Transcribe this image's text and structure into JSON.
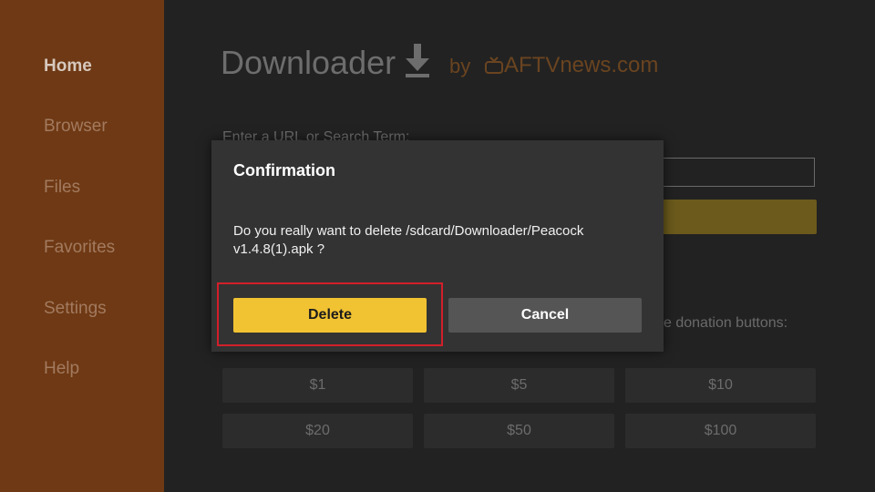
{
  "sidebar": {
    "items": [
      {
        "label": "Home",
        "active": true
      },
      {
        "label": "Browser"
      },
      {
        "label": "Files"
      },
      {
        "label": "Favorites"
      },
      {
        "label": "Settings"
      },
      {
        "label": "Help"
      }
    ]
  },
  "header": {
    "title": "Downloader",
    "by": "by",
    "brand": "AFTVnews.com",
    "download_icon": "download-arrow-icon",
    "brand_icon": "tv-icon"
  },
  "main": {
    "url_label": "Enter a URL or Search Term:",
    "donation_label": "se donation buttons:",
    "donation_buttons": [
      "$1",
      "$5",
      "$10",
      "$20",
      "$50",
      "$100"
    ]
  },
  "dialog": {
    "title": "Confirmation",
    "message": "Do you really want to delete /sdcard/Downloader/Peacock v1.4.8(1).apk ?",
    "delete_label": "Delete",
    "cancel_label": "Cancel"
  },
  "colors": {
    "sidebar_bg": "#6e3914",
    "accent_yellow": "#f1c232",
    "highlight_red": "#d21f2a"
  }
}
